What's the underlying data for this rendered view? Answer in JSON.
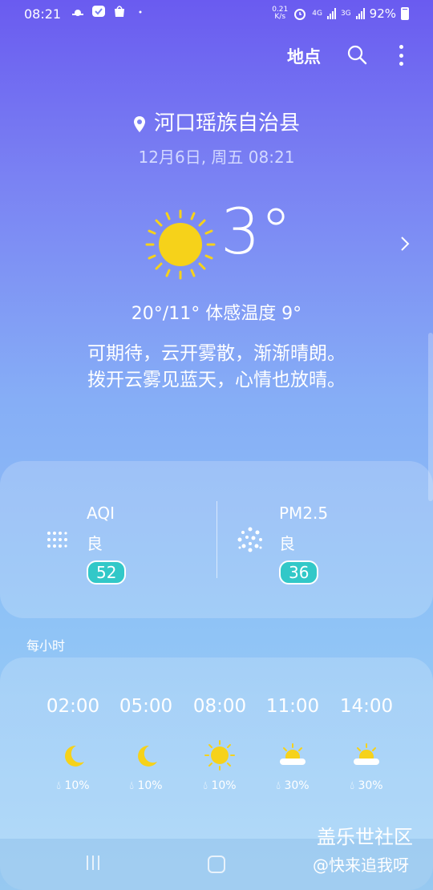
{
  "status_bar": {
    "time": "08:21",
    "net_speed_value": "0.21",
    "net_speed_unit": "K/s",
    "network_4g": "4G",
    "network_3g": "3G",
    "battery": "92%"
  },
  "toolbar": {
    "locations_label": "地点"
  },
  "location": {
    "city": "河口瑶族自治县",
    "datetime": "12月6日, 周五 08:21"
  },
  "current": {
    "temperature": "3°",
    "range_feels": "20°/11° 体感温度 9°",
    "description_line1": "可期待，云开雾散，渐渐晴朗。",
    "description_line2": "拨开云雾见蓝天，心情也放晴。"
  },
  "air": {
    "aqi": {
      "label": "AQI",
      "level": "良",
      "value": "52"
    },
    "pm25": {
      "label": "PM2.5",
      "level": "良",
      "value": "36"
    }
  },
  "hourly": {
    "title": "每小时",
    "items": [
      {
        "time": "02:00",
        "icon": "moon-icon",
        "precip": "10%"
      },
      {
        "time": "05:00",
        "icon": "moon-icon",
        "precip": "10%"
      },
      {
        "time": "08:00",
        "icon": "sun-icon",
        "precip": "10%"
      },
      {
        "time": "11:00",
        "icon": "partly-cloudy-icon",
        "precip": "30%"
      },
      {
        "time": "14:00",
        "icon": "partly-cloudy-icon",
        "precip": "30%"
      }
    ]
  },
  "watermark": {
    "line1": "盖乐世社区",
    "line2": "@快来追我呀"
  },
  "colors": {
    "sun": "#f6d21a",
    "badge": "#32c8c8",
    "bg_top": "#6a5bf0",
    "bg_bottom": "#a3d4f7"
  }
}
